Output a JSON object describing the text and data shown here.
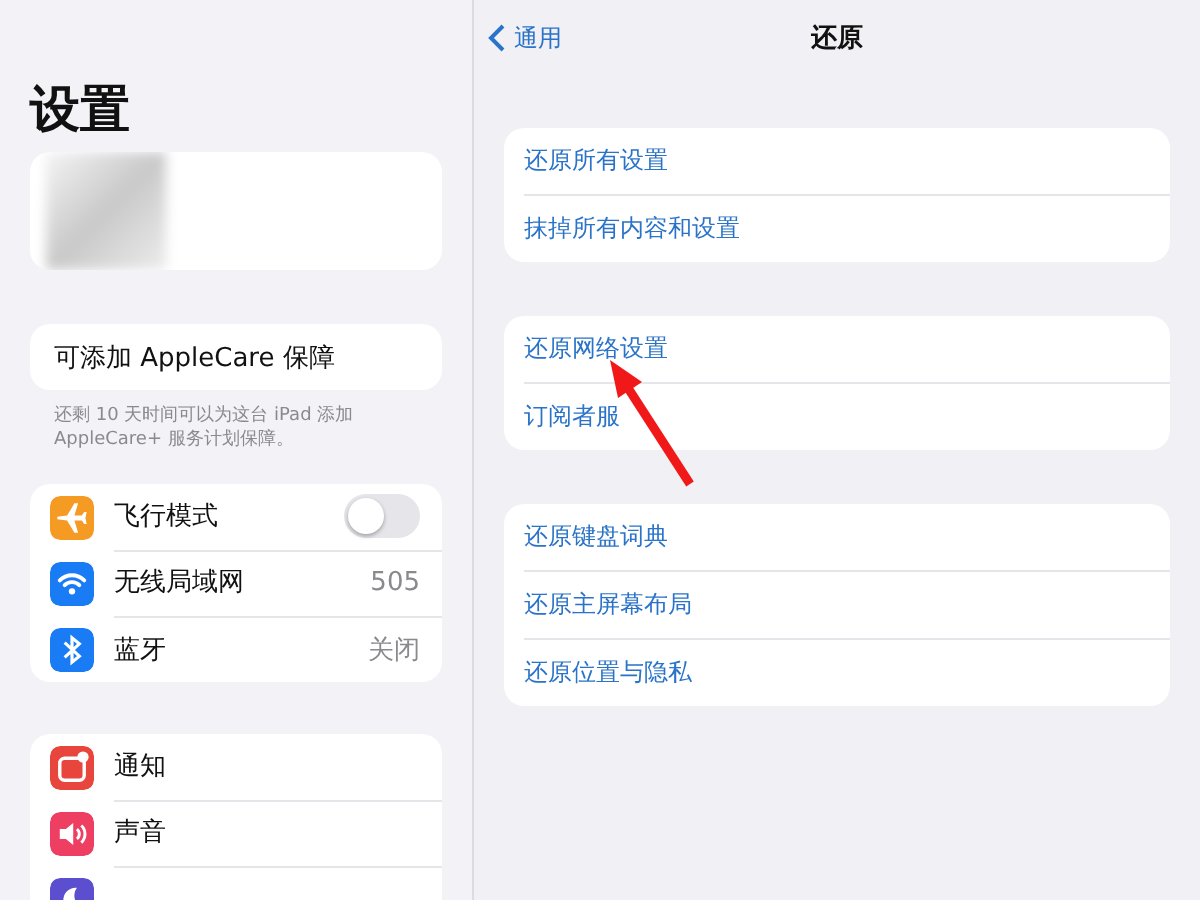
{
  "sidebar": {
    "title": "设置",
    "applecare": {
      "label": "可添加 AppleCare 保障",
      "note": "还剩 10 天时间可以为这台 iPad 添加 AppleCare+ 服务计划保障。"
    },
    "groups": [
      {
        "items": [
          {
            "kind": "toggle",
            "label": "飞行模式",
            "on": false,
            "color": "#f59a23"
          },
          {
            "kind": "value",
            "label": "无线局域网",
            "value": "505",
            "color": "#1a7cf5"
          },
          {
            "kind": "value",
            "label": "蓝牙",
            "value": "关闭",
            "color": "#1a7cf5"
          }
        ]
      },
      {
        "items": [
          {
            "kind": "link",
            "label": "通知",
            "color": "#e8463c"
          },
          {
            "kind": "link",
            "label": "声音",
            "color": "#ee3f63"
          },
          {
            "kind": "cut",
            "color": "#5b4fd0"
          }
        ]
      }
    ]
  },
  "detail": {
    "back": "通用",
    "title": "还原",
    "groups": [
      [
        "还原所有设置",
        "抹掉所有内容和设置"
      ],
      [
        "还原网络设置",
        "订阅者服"
      ],
      [
        "还原键盘词典",
        "还原主屏幕布局",
        "还原位置与隐私"
      ]
    ]
  }
}
